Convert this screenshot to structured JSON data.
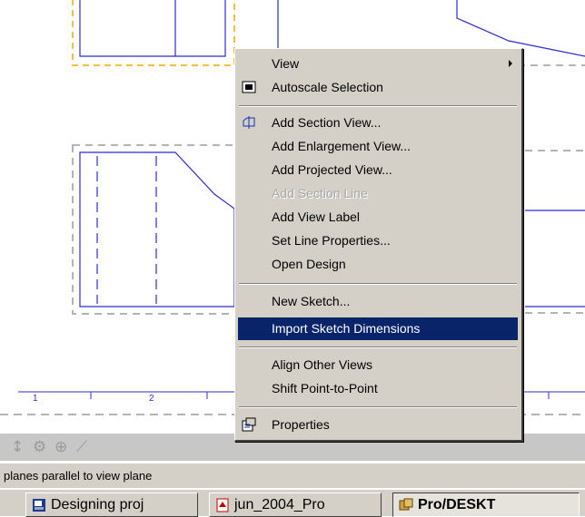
{
  "context_menu": {
    "items": [
      {
        "label": "View",
        "has_submenu": true,
        "icon": null,
        "state": "normal"
      },
      {
        "label": "Autoscale Selection",
        "icon": "autoscale-icon",
        "state": "normal"
      },
      {
        "label": "Add Section View...",
        "icon": "section-view-icon",
        "state": "normal"
      },
      {
        "label": "Add Enlargement View...",
        "icon": null,
        "state": "normal"
      },
      {
        "label": "Add Projected View...",
        "icon": null,
        "state": "normal"
      },
      {
        "label": "Add Section Line",
        "icon": null,
        "state": "disabled"
      },
      {
        "label": "Add View Label",
        "icon": null,
        "state": "normal"
      },
      {
        "label": "Set Line Properties...",
        "icon": null,
        "state": "normal"
      },
      {
        "label": "Open Design",
        "icon": null,
        "state": "normal"
      },
      {
        "label": "New Sketch...",
        "icon": null,
        "state": "normal"
      },
      {
        "label": "Import Sketch Dimensions",
        "icon": null,
        "state": "highlighted"
      },
      {
        "label": "Align Other Views",
        "icon": null,
        "state": "normal"
      },
      {
        "label": "Shift Point-to-Point",
        "icon": null,
        "state": "normal"
      },
      {
        "label": "Properties",
        "icon": "properties-icon",
        "state": "normal"
      }
    ]
  },
  "ruler": {
    "labels": [
      "1",
      "2"
    ]
  },
  "toolbar": {
    "glyphs": [
      "↕",
      "⚙",
      "⊕",
      "⟋"
    ]
  },
  "status_bar": {
    "text": "planes parallel to view plane"
  },
  "taskbar": {
    "buttons": [
      {
        "label": "Designing proj",
        "icon": "document-icon",
        "active": false
      },
      {
        "label": "jun_2004_Pro",
        "icon": "pdf-icon",
        "active": false
      },
      {
        "label": "Pro/DESKT",
        "icon": "prodesktop-icon",
        "active": true
      }
    ]
  },
  "colors": {
    "menu_bg": "#d4d0c8",
    "highlight": "#0a246a",
    "drawing_line": "#2b2bd6",
    "view_border": "#b4b4b4",
    "selected_view_border": "#f0c040"
  }
}
